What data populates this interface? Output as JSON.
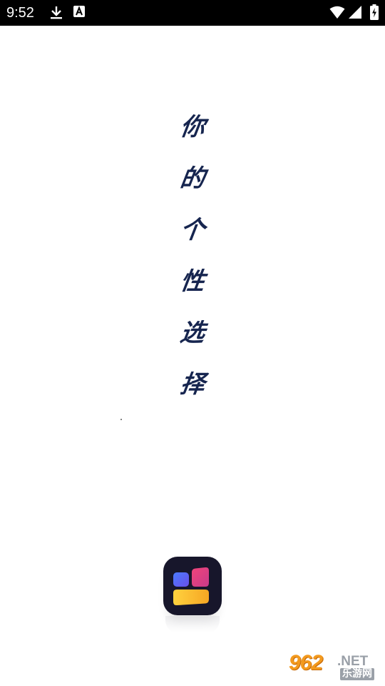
{
  "status_bar": {
    "time": "9:52",
    "icons": [
      "download-icon",
      "a-notification-icon",
      "wifi-icon",
      "signal-icon",
      "battery-charging-icon"
    ],
    "background": "#000000",
    "foreground": "#ffffff"
  },
  "splash": {
    "slogan_chars": [
      "你",
      "的",
      "个",
      "性",
      "选",
      "择"
    ],
    "slogan_color": "#16254f",
    "app_icon": {
      "name": "app-logo-icon",
      "background": "#17162b",
      "tile_colors": [
        "#3f6cf0",
        "#e0407a",
        "#f5c230"
      ]
    }
  },
  "watermark": {
    "number": "962",
    "domain": ".NET",
    "site_name": "乐游网",
    "number_color": "#f39a1e",
    "text_color": "#9aa0a8"
  }
}
